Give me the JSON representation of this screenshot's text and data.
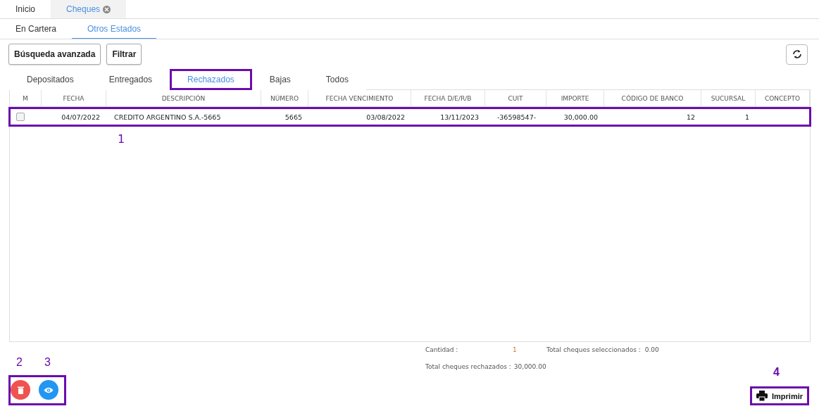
{
  "top_tabs": [
    {
      "label": "Inicio",
      "selected": false,
      "closable": false
    },
    {
      "label": "Cheques",
      "selected": true,
      "closable": true
    }
  ],
  "sub_tabs": [
    {
      "label": "En Cartera",
      "selected": false
    },
    {
      "label": "Otros Estados",
      "selected": true
    }
  ],
  "toolbar": {
    "buttons": [
      "Búsqueda avanzada",
      "Filtrar"
    ]
  },
  "status_tabs": [
    {
      "label": "Depositados",
      "selected": false,
      "highlighted": false
    },
    {
      "label": "Entregados",
      "selected": false,
      "highlighted": false
    },
    {
      "label": "Rechazados",
      "selected": true,
      "highlighted": true
    },
    {
      "label": "Bajas",
      "selected": false,
      "highlighted": false
    },
    {
      "label": "Todos",
      "selected": false,
      "highlighted": false
    }
  ],
  "table": {
    "columns": [
      "M",
      "FECHA",
      "DESCRIPCIÓN",
      "NÚMERO",
      "FECHA VENCIMIENTO",
      "FECHA D/E/R/B",
      "CUIT",
      "IMPORTE",
      "CÓDIGO DE BANCO",
      "SUCURSAL",
      "CONCEPTO"
    ],
    "rows": [
      {
        "highlighted": true,
        "annotation": "1",
        "cells": [
          {
            "kind": "checkbox",
            "checked": false
          },
          "04/07/2022",
          "CREDITO ARGENTINO S.A.-5665",
          "5665",
          "03/08/2022",
          "13/11/2023",
          "-36598547-",
          "30,000.00",
          "12",
          "1"
        ]
      }
    ]
  },
  "summary": [
    {
      "label": "Cantidad :",
      "value": "1"
    },
    {
      "label": "Total cheques seleccionados :",
      "value": "0.00"
    },
    {
      "label": "Total cheques rechazados :",
      "value": "30,000.00"
    }
  ],
  "actions": {
    "highlighted": true,
    "buttons": [
      {
        "kind": "delete",
        "annotation": "2"
      },
      {
        "kind": "view",
        "annotation": "3"
      }
    ]
  },
  "print": {
    "label": "Imprimir",
    "highlighted": true,
    "annotation": "4"
  }
}
